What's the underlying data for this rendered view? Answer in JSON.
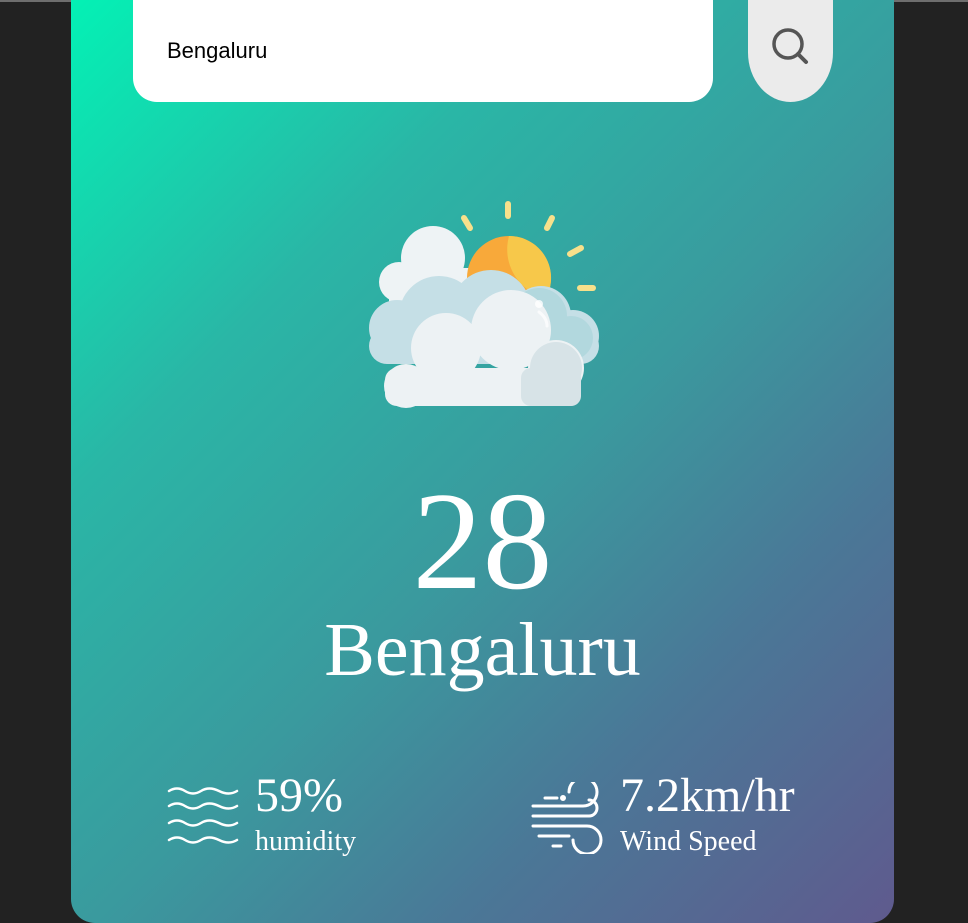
{
  "search": {
    "value": "Bengaluru",
    "button_icon": "search-icon"
  },
  "weather": {
    "icon": "partly-cloudy-icon",
    "temperature": "28",
    "city": "Bengaluru"
  },
  "details": {
    "humidity": {
      "value": "59%",
      "label": "humidity",
      "icon": "humidity-waves-icon"
    },
    "wind": {
      "value": "7.2km/hr",
      "label": "Wind Speed",
      "icon": "wind-icon"
    }
  },
  "colors": {
    "gradient_start": "#00f6b6",
    "gradient_end": "#5f5a8e",
    "page_background": "#222222"
  }
}
